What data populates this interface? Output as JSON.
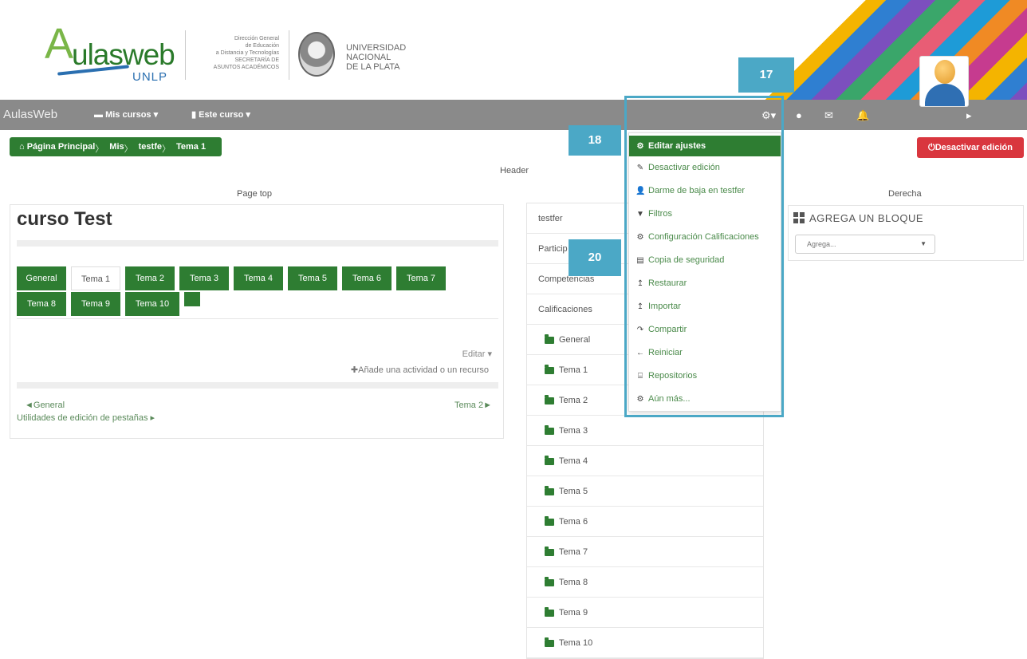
{
  "branding": {
    "logo_text": "ulasweb",
    "logo_initial": "A",
    "logo_sub": "UNLP",
    "secretaria": [
      "Dirección General",
      "de Educación",
      "a Distancia y Tecnologías",
      "SECRETARÍA DE",
      "ASUNTOS ACADÉMICOS"
    ],
    "university": [
      "UNIVERSIDAD",
      "NACIONAL",
      "DE LA PLATA"
    ]
  },
  "navbar": {
    "brand": "AulasWeb",
    "my_courses": "Mis cursos ▾",
    "this_course": "Este curso ▾",
    "gear": "⚙▾",
    "globe": "●",
    "mail": "✉",
    "bell": "🔔",
    "user_caret": "▸"
  },
  "breadcrumb": [
    "Página Principal",
    "Mis",
    "testfe",
    "Tema 1"
  ],
  "breadcrumb_home_icon": "home-icon",
  "header_label": "Header",
  "pagetop_label": "Page top",
  "derecha_label": "Derecha",
  "desactivar_button": "Desactivar edición",
  "course": {
    "title": "curso Test",
    "tabs_row1": [
      "General",
      "Tema 1",
      "Tema 2",
      "Tema 3",
      "Tema 4",
      "Tema 5",
      "Tema 6",
      "Tema 7"
    ],
    "tabs_row2": [
      "Tema 8",
      "Tema 9",
      "Tema 10"
    ],
    "active_tab": "Tema 1",
    "edit": "Editar ▾",
    "add_activity": "Añade una actividad o un recurso",
    "prev": "◄General",
    "next": "Tema 2►",
    "utilities": "Utilidades de edición de pestañas ▸"
  },
  "middle_nav": {
    "rows": [
      "testfer",
      "Particip",
      "Competencias",
      "Calificaciones"
    ],
    "topics": [
      "General",
      "Tema 1",
      "Tema 2",
      "Tema 3",
      "Tema 4",
      "Tema 5",
      "Tema 6",
      "Tema 7",
      "Tema 8",
      "Tema 9",
      "Tema 10"
    ]
  },
  "settings_menu": [
    {
      "label": "Editar ajustes",
      "icon": "gear-icon",
      "glyph": "⚙"
    },
    {
      "label": "Desactivar edición",
      "icon": "pencil-icon",
      "glyph": "✎"
    },
    {
      "label": "Darme de baja en testfer",
      "icon": "user-icon",
      "glyph": "👤"
    },
    {
      "label": "Filtros",
      "icon": "filter-icon",
      "glyph": "▼"
    },
    {
      "label": "Configuración Calificaciones",
      "icon": "gear-icon",
      "glyph": "⚙"
    },
    {
      "label": "Copia de seguridad",
      "icon": "file-icon",
      "glyph": "▤"
    },
    {
      "label": "Restaurar",
      "icon": "upload-icon",
      "glyph": "↥"
    },
    {
      "label": "Importar",
      "icon": "upload-icon",
      "glyph": "↥"
    },
    {
      "label": "Compartir",
      "icon": "share-icon",
      "glyph": "↷"
    },
    {
      "label": "Reiniciar",
      "icon": "arrow-left-icon",
      "glyph": "←"
    },
    {
      "label": "Repositorios",
      "icon": "hdd-icon",
      "glyph": "⌸"
    },
    {
      "label": "Aún más...",
      "icon": "gear-icon",
      "glyph": "⚙"
    }
  ],
  "callouts": [
    "17",
    "18",
    "20"
  ],
  "right_block": {
    "title": "AGREGA UN BLOQUE",
    "select_value": "Agrega..."
  },
  "colors": {
    "primary_green": "#2e7d32",
    "navbar_grey": "#8a8a8a",
    "danger_red": "#d9363e",
    "callout_blue": "#4ba8c6"
  }
}
